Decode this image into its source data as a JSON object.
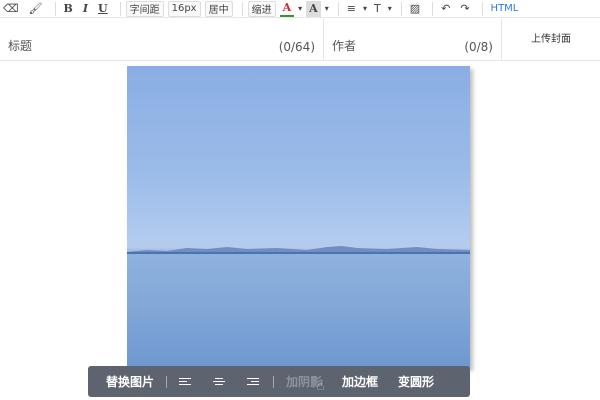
{
  "toolbar": {
    "bold": "B",
    "italic": "I",
    "underline": "U",
    "letter_spacing": "字间距",
    "font_size": "16px",
    "center": "居中",
    "indent": "缩进",
    "font_color": "A",
    "bg_color": "A",
    "list": "≡",
    "text_style": "T",
    "html": "HTML"
  },
  "fields": {
    "title_label": "标题",
    "title_count": "(0/64)",
    "author_label": "作者",
    "author_count": "(0/8)",
    "upload_cover": "上传封面"
  },
  "image_toolbar": {
    "replace": "替换图片",
    "shadow": "加阴影",
    "border": "加边框",
    "round": "变圆形"
  },
  "colors": {
    "accent": "#2a7ae2",
    "float_bg": "#5d6470",
    "font_color_red": "#d9252c"
  }
}
